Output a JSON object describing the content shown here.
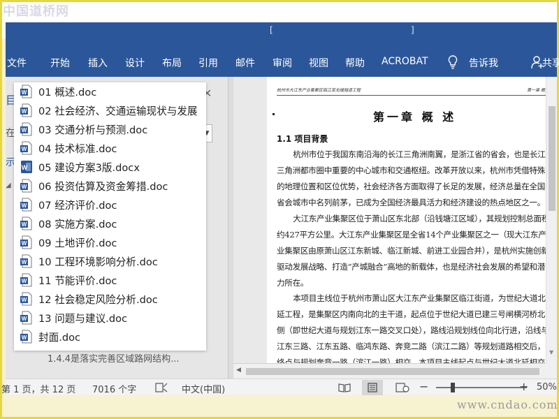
{
  "watermark_top": "中国道桥网",
  "watermark_bottom": "www.cndao.com",
  "titlebar": {
    "left_fragment": "[",
    "right_fragment": "]"
  },
  "ribbon": {
    "tabs": [
      "文件",
      "开始",
      "插入",
      "设计",
      "布局",
      "引用",
      "邮件",
      "审阅",
      "视图",
      "帮助",
      "ACROBAT"
    ],
    "tell_me": "告诉我",
    "share": "共享"
  },
  "navigation": {
    "partial_labels": [
      "目",
      "在",
      "示"
    ],
    "collapsed_heading": "1.4.4是落实完善区域路网结构..."
  },
  "file_list": {
    "items": [
      {
        "name": "01 概述.doc",
        "icon": "word-doc-icon"
      },
      {
        "name": "02 社会经济、交通运输现状与发展",
        "icon": "word-doc-icon"
      },
      {
        "name": "03 交通分析与预测.doc",
        "icon": "word-doc-icon"
      },
      {
        "name": "04 技术标准.doc",
        "icon": "word-doc-icon"
      },
      {
        "name": "05 建设方案3版.docx",
        "icon": "word-docx-icon"
      },
      {
        "name": "06 投资估算及资金筹措.doc",
        "icon": "word-doc-icon"
      },
      {
        "name": "07 经济评价.doc",
        "icon": "word-doc-icon"
      },
      {
        "name": "08 实施方案.doc",
        "icon": "word-doc-icon"
      },
      {
        "name": "09 土地评价.doc",
        "icon": "word-doc-icon"
      },
      {
        "name": "10 工程环境影响分析.doc",
        "icon": "word-doc-icon"
      },
      {
        "name": "11 节能评价.doc",
        "icon": "word-doc-icon"
      },
      {
        "name": "12 社会稳定风险分析.doc",
        "icon": "word-doc-icon"
      },
      {
        "name": "13 问题与建议.doc",
        "icon": "word-doc-icon"
      },
      {
        "name": "封面.doc",
        "icon": "word-doc-icon"
      }
    ]
  },
  "document": {
    "header_left": "杭州市大江东产业集聚区临江至无缝隧道工程",
    "header_right": "第一章 概述",
    "chapter_title": "第一章  概  述",
    "section_title": "1.1 项目背景",
    "paragraphs": [
      "杭州市位于我国东南沿海的长江三角洲南翼，是浙江省的省会，也是长江三角洲都市圈中重要的中心城市和交通枢纽。改革开放以来，杭州市凭借特殊的地理位置和区位优势，社会经济各方面取得了长足的发展，经济总量在全国省会城市中名列前茅，已成为全国经济最具活力和经济建设的热点地区之一。",
      "大江东产业集聚区位于萧山区东北部（沿钱塘江区域），其规划控制总面积约427平方公里。大江东产业集聚区是全省14个产业集聚区之一（现大江东产业集聚区由原萧山区江东新城、临江新城、前进工业园合并），是杭州实施创新驱动发展战略、打造“产城融合”高地的新载体，也是经济社会发展的希望和潜力所在。",
      "本项目主线位于杭州市萧山区大江东产业集聚区临江街道，为世纪大道北延工程，是集聚区内南向北的主干道，起点位于世纪大道已建三号闸横河桥北侧（即世纪大道与规划江东一路交叉口处），路线沿规划线位向北行进，沿线与江东三路、江东五路、临鸿东路、奔竞二路（滨江二路）等规划道路相交后，终点与规划奔竞一路（滨江一路）相交。本项目主线起点与世纪大道北延相交"
    ]
  },
  "statusbar": {
    "page_info": "第 1 页，共 12 页",
    "word_count": "7016 个字",
    "language": "中文(中国)",
    "zoom_minus": "−",
    "zoom_plus": "+",
    "zoom_level": "50%"
  }
}
